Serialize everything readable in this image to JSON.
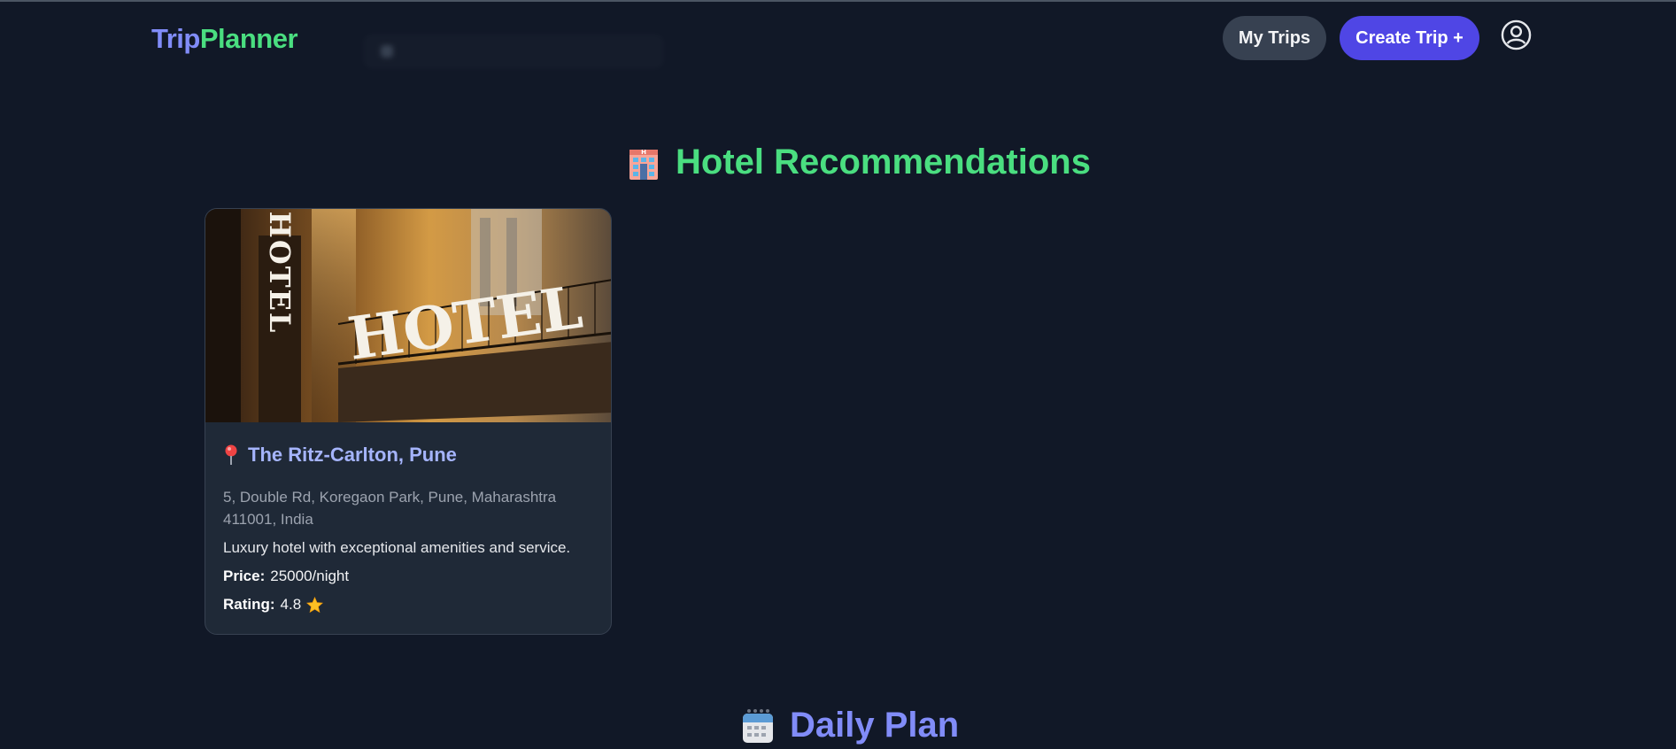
{
  "app": {
    "logo_part1": "Trip",
    "logo_part2": "Planner"
  },
  "nav": {
    "my_trips_label": "My Trips",
    "create_trip_label": "Create Trip +",
    "user_icon": "user-circle-icon"
  },
  "colors": {
    "background": "#111827",
    "card": "#1f2937",
    "accent_green": "#4ade80",
    "accent_indigo": "#818cf8",
    "primary_button": "#4f46e5",
    "secondary_button": "#374151"
  },
  "hotels_section": {
    "title": "Hotel Recommendations",
    "icon": "hotel-emoji-icon",
    "hotels": [
      {
        "name": "The Ritz-Carlton, Pune",
        "address": "5, Double Rd, Koregaon Park, Pune, Maharashtra 411001, India",
        "description": "Luxury hotel with exceptional amenities and service.",
        "price_label": "Price:",
        "price_value": "25000/night",
        "rating_label": "Rating:",
        "rating_value": "4.8",
        "image_sign_vertical": "HOTEL",
        "image_sign_main": "HOTEL"
      }
    ]
  },
  "daily_plan_section": {
    "title": "Daily Plan",
    "icon": "calendar-emoji-icon"
  }
}
